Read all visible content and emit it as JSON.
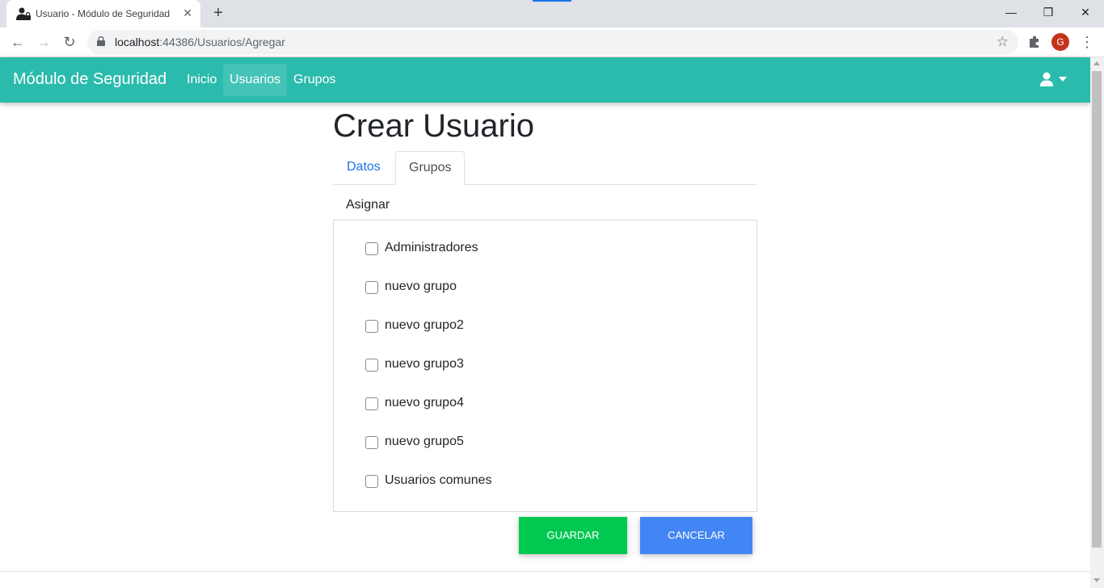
{
  "browser": {
    "tab_title": "Usuario - Módulo de Seguridad",
    "close_glyph": "✕",
    "new_tab_glyph": "+",
    "url_host": "localhost",
    "url_path": ":44386/Usuarios/Agregar",
    "profile_initial": "G",
    "window": {
      "minimize": "—",
      "restore": "❐",
      "close": "✕"
    },
    "nav": {
      "back": "←",
      "forward": "→",
      "reload": "↻",
      "star": "☆",
      "menu": "⋮"
    }
  },
  "navbar": {
    "brand": "Módulo de Seguridad",
    "links": [
      {
        "label": "Inicio",
        "active": false
      },
      {
        "label": "Usuarios",
        "active": true
      },
      {
        "label": "Grupos",
        "active": false
      }
    ],
    "user_icon": "user-icon"
  },
  "page": {
    "title": "Crear Usuario",
    "tabs": [
      {
        "label": "Datos",
        "active": false
      },
      {
        "label": "Grupos",
        "active": true
      }
    ],
    "assign_label": "Asignar",
    "groups": [
      {
        "label": "Administradores",
        "checked": false
      },
      {
        "label": "nuevo grupo",
        "checked": false
      },
      {
        "label": "nuevo grupo2",
        "checked": false
      },
      {
        "label": "nuevo grupo3",
        "checked": false
      },
      {
        "label": "nuevo grupo4",
        "checked": false
      },
      {
        "label": "nuevo grupo5",
        "checked": false
      },
      {
        "label": "Usuarios comunes",
        "checked": false
      }
    ],
    "save_label": "Guardar",
    "cancel_label": "Cancelar"
  },
  "colors": {
    "navbar": "#2bbbad",
    "save": "#00c851",
    "cancel": "#4285f4",
    "link": "#1a73e8"
  }
}
